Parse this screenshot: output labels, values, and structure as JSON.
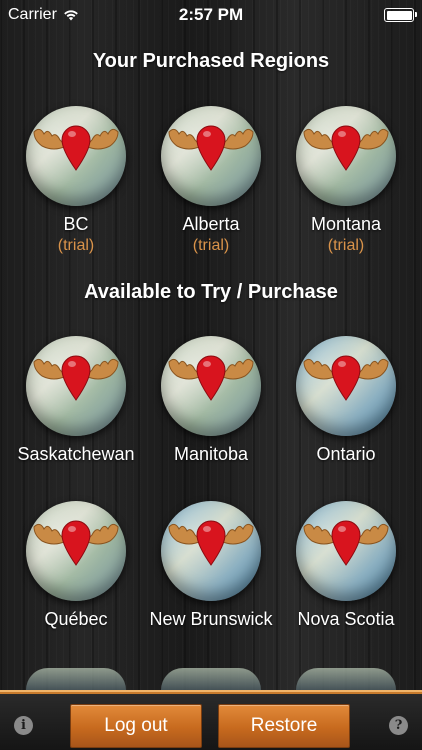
{
  "status": {
    "carrier": "Carrier",
    "time": "2:57 PM"
  },
  "sections": {
    "purchased_title": "Your Purchased Regions",
    "available_title": "Available to Try / Purchase"
  },
  "purchased": [
    {
      "name": "BC",
      "note": "(trial)"
    },
    {
      "name": "Alberta",
      "note": "(trial)"
    },
    {
      "name": "Montana",
      "note": "(trial)"
    }
  ],
  "available": [
    {
      "name": "Saskatchewan"
    },
    {
      "name": "Manitoba"
    },
    {
      "name": "Ontario"
    },
    {
      "name": "Québec"
    },
    {
      "name": "New Brunswick"
    },
    {
      "name": "Nova Scotia"
    }
  ],
  "toolbar": {
    "logout_label": "Log out",
    "restore_label": "Restore",
    "info_glyph": "i",
    "help_glyph": "?"
  },
  "colors": {
    "accent": "#c77a2c",
    "trial_text": "#d9934a",
    "pin": "#d8141e",
    "antler": "#c98a45"
  }
}
